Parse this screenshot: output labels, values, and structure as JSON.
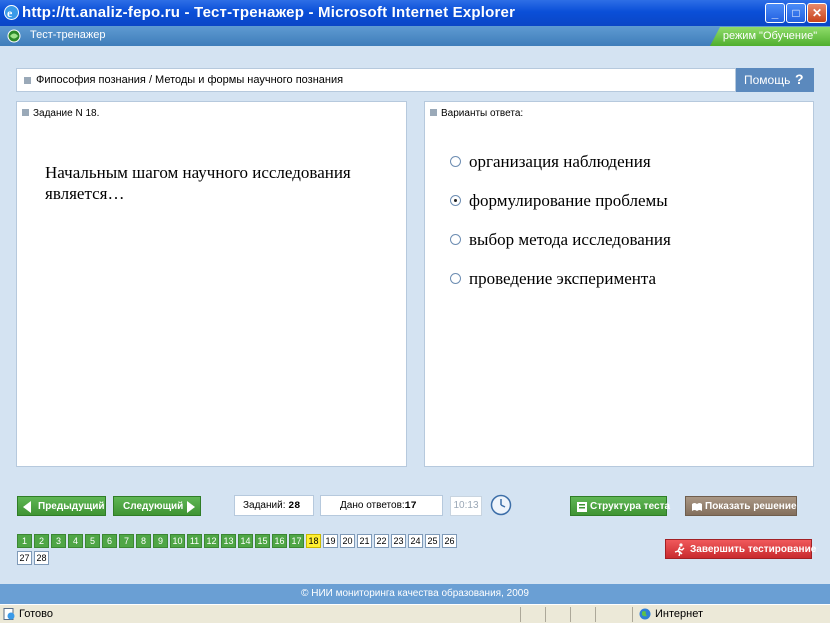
{
  "window": {
    "title": "http://tt.analiz-fepo.ru - Тест-тренажер - Microsoft Internet Explorer",
    "minimize": "_",
    "maximize": "□",
    "close": "✕"
  },
  "app": {
    "title": "Тест-тренажер",
    "mode": "режим \"Обучение\""
  },
  "breadcrumb": "Фипософия познания / Методы и формы научного познания",
  "help": {
    "label": "Помощь",
    "icon": "?"
  },
  "task": {
    "header": "Задание N 18.",
    "question": "Начальным шагом научного исследования является…"
  },
  "answers": {
    "header": "Варианты ответа:",
    "options": [
      {
        "text": "организация наблюдения",
        "selected": false
      },
      {
        "text": "формулирование проблемы",
        "selected": true
      },
      {
        "text": "выбор метода исследования",
        "selected": false
      },
      {
        "text": "проведение эксперимента",
        "selected": false
      }
    ]
  },
  "controls": {
    "prev": "Предыдущий",
    "next": "Следующий",
    "tasks_label": "Заданий:",
    "tasks_count": "28",
    "answered_label": "Дано ответов:",
    "answered_count": "17",
    "timer": "10:13",
    "structure": "Структура теста",
    "show_solution": "Показать решение",
    "finish": "Завершить тестирование"
  },
  "question_numbers": [
    {
      "n": "1",
      "state": "done"
    },
    {
      "n": "2",
      "state": "done"
    },
    {
      "n": "3",
      "state": "done"
    },
    {
      "n": "4",
      "state": "done"
    },
    {
      "n": "5",
      "state": "done"
    },
    {
      "n": "6",
      "state": "done"
    },
    {
      "n": "7",
      "state": "done"
    },
    {
      "n": "8",
      "state": "done"
    },
    {
      "n": "9",
      "state": "done"
    },
    {
      "n": "10",
      "state": "done"
    },
    {
      "n": "11",
      "state": "done"
    },
    {
      "n": "12",
      "state": "done"
    },
    {
      "n": "13",
      "state": "done"
    },
    {
      "n": "14",
      "state": "done"
    },
    {
      "n": "15",
      "state": "done"
    },
    {
      "n": "16",
      "state": "done"
    },
    {
      "n": "17",
      "state": "done"
    },
    {
      "n": "18",
      "state": "cur"
    },
    {
      "n": "19",
      "state": "todo"
    },
    {
      "n": "20",
      "state": "todo"
    },
    {
      "n": "21",
      "state": "todo"
    },
    {
      "n": "22",
      "state": "todo"
    },
    {
      "n": "23",
      "state": "todo"
    },
    {
      "n": "24",
      "state": "todo"
    },
    {
      "n": "25",
      "state": "todo"
    },
    {
      "n": "26",
      "state": "todo"
    },
    {
      "n": "27",
      "state": "todo"
    },
    {
      "n": "28",
      "state": "todo"
    }
  ],
  "footer": "© НИИ мониторинга качества образования, 2009",
  "status": {
    "ready": "Готово",
    "zone": "Интернет"
  },
  "colors": {
    "accent_blue": "#5b89bd",
    "done_green": "#4fa646",
    "current_yellow": "#ffef33",
    "finish_red": "#c92a2e"
  }
}
